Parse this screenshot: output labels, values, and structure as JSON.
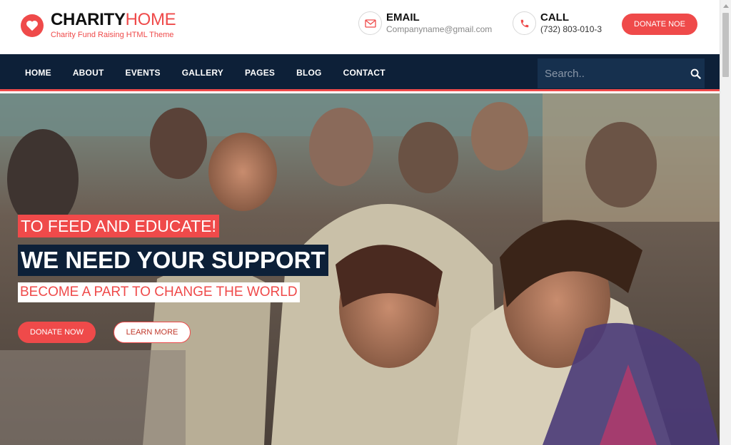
{
  "brand": {
    "title_part1": "CHARITY",
    "title_part2": "HOME",
    "subtitle": "Charity Fund Raising HTML Theme",
    "icon": "heart-icon",
    "accent": "#ef4a4a"
  },
  "contacts": {
    "email": {
      "label": "EMAIL",
      "value": "Companyname@gmail.com",
      "icon": "envelope-icon"
    },
    "call": {
      "label": "CALL",
      "value": "(732) 803-010-3",
      "icon": "phone-icon"
    }
  },
  "header": {
    "donate_label": "DONATE NOE"
  },
  "nav": {
    "items": [
      {
        "label": "HOME"
      },
      {
        "label": "ABOUT"
      },
      {
        "label": "EVENTS"
      },
      {
        "label": "GALLERY"
      },
      {
        "label": "PAGES"
      },
      {
        "label": "BLOG"
      },
      {
        "label": "CONTACT"
      }
    ],
    "background": "#0d2038"
  },
  "search": {
    "placeholder": "Search..",
    "icon": "search-icon"
  },
  "hero": {
    "line1": "TO FEED AND EDUCATE!",
    "line2": "WE NEED YOUR SUPPORT",
    "line3": "BECOME A PART TO CHANGE THE WORLD",
    "donate_label": "DONATE NOW",
    "learn_label": "LEARN MORE"
  }
}
